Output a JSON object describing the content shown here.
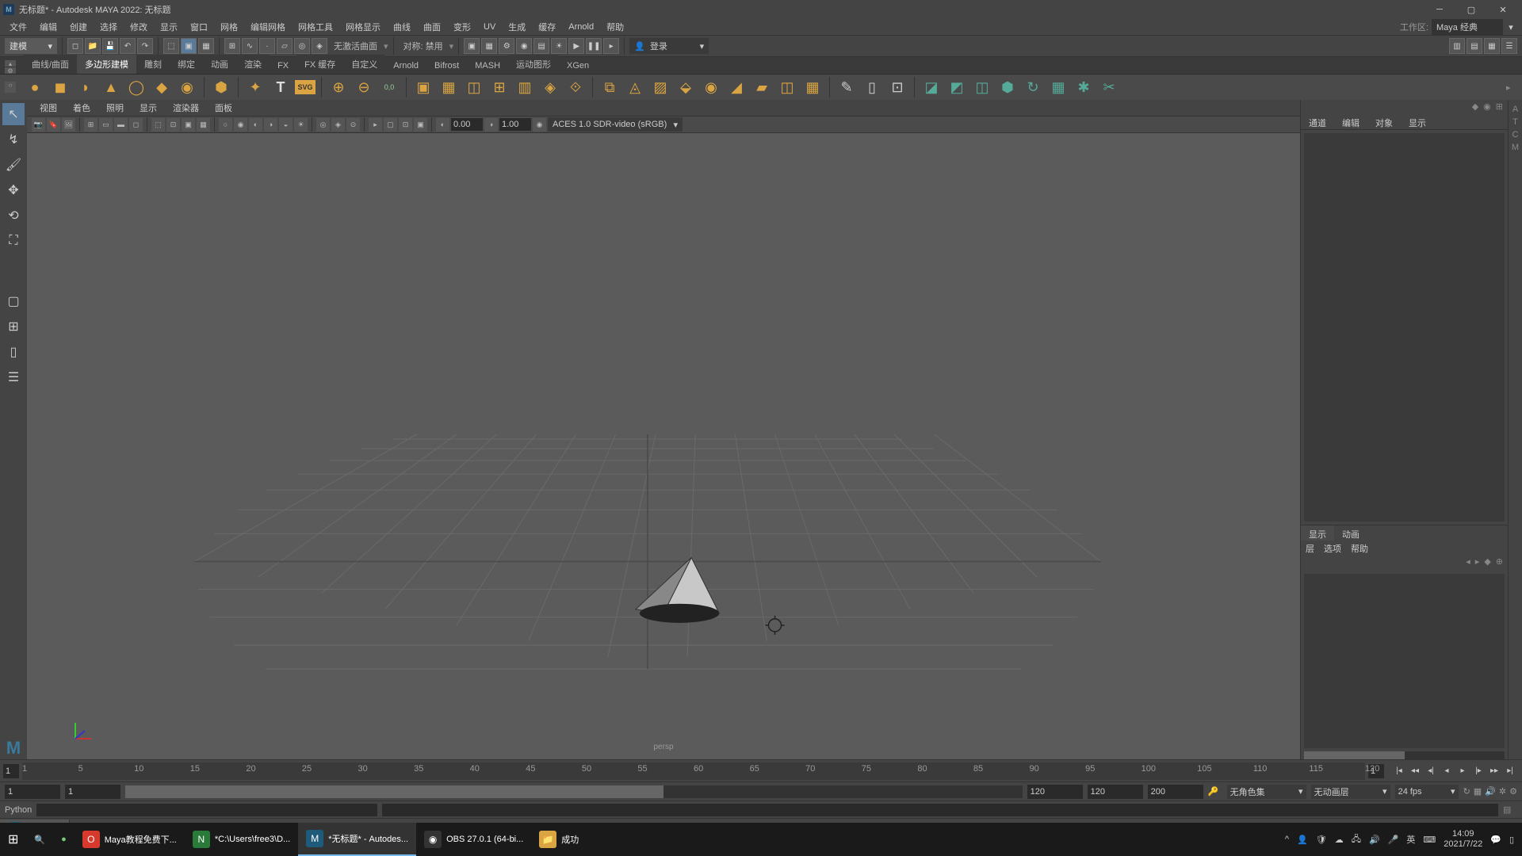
{
  "title": "无标题* - Autodesk MAYA 2022: 无标题",
  "menus": [
    "文件",
    "编辑",
    "创建",
    "选择",
    "修改",
    "显示",
    "窗口",
    "网格",
    "编辑网格",
    "网格工具",
    "网格显示",
    "曲线",
    "曲面",
    "变形",
    "UV",
    "生成",
    "缓存",
    "Arnold",
    "帮助"
  ],
  "workspace": {
    "label": "工作区:",
    "value": "Maya 经典"
  },
  "modeDropdown": "建模",
  "toolbar": {
    "noActiveSurface": "无激活曲面",
    "symmetry": "对称: 禁用",
    "login": "登录"
  },
  "shelfTabs": [
    "曲线/曲面",
    "多边形建模",
    "雕刻",
    "绑定",
    "动画",
    "渲染",
    "FX",
    "FX 缓存",
    "自定义",
    "Arnold",
    "Bifrost",
    "MASH",
    "运动图形",
    "XGen"
  ],
  "shelfActiveTab": 1,
  "vpMenus": [
    "视图",
    "着色",
    "照明",
    "显示",
    "渲染器",
    "面板"
  ],
  "vpFields": {
    "a": "0.00",
    "b": "1.00"
  },
  "colorMgmt": "ACES 1.0 SDR-video (sRGB)",
  "perspLabel": "persp",
  "rightTabs": [
    "通道",
    "编辑",
    "对象",
    "显示"
  ],
  "layerTabs": [
    "显示",
    "动画"
  ],
  "layerMenu": [
    "层",
    "选项",
    "帮助"
  ],
  "timeline": {
    "start": "1",
    "end": "1",
    "ticks": [
      1,
      5,
      10,
      15,
      20,
      25,
      30,
      35,
      40,
      45,
      50,
      55,
      60,
      65,
      70,
      75,
      80,
      85,
      90,
      95,
      100,
      105,
      110,
      115,
      120
    ]
  },
  "range": {
    "a": "1",
    "b": "1",
    "c": "120",
    "d": "120",
    "e": "200",
    "charset": "无角色集",
    "animlayer": "无动画层",
    "fps": "24 fps"
  },
  "cmd": {
    "lang": "Python"
  },
  "openTab": "M",
  "taskbar": {
    "items": [
      {
        "label": "Maya教程免费下...",
        "color": "#d73a2c"
      },
      {
        "label": "*C:\\Users\\free3\\D...",
        "color": "#2a7a3a"
      },
      {
        "label": "*无标题* - Autodes...",
        "color": "#1e5a7a",
        "active": true
      },
      {
        "label": "OBS 27.0.1 (64-bi...",
        "color": "#333"
      },
      {
        "label": "成功",
        "color": "#d9a441"
      }
    ],
    "ime": "英",
    "time": "14:09",
    "date": "2021/7/22"
  }
}
